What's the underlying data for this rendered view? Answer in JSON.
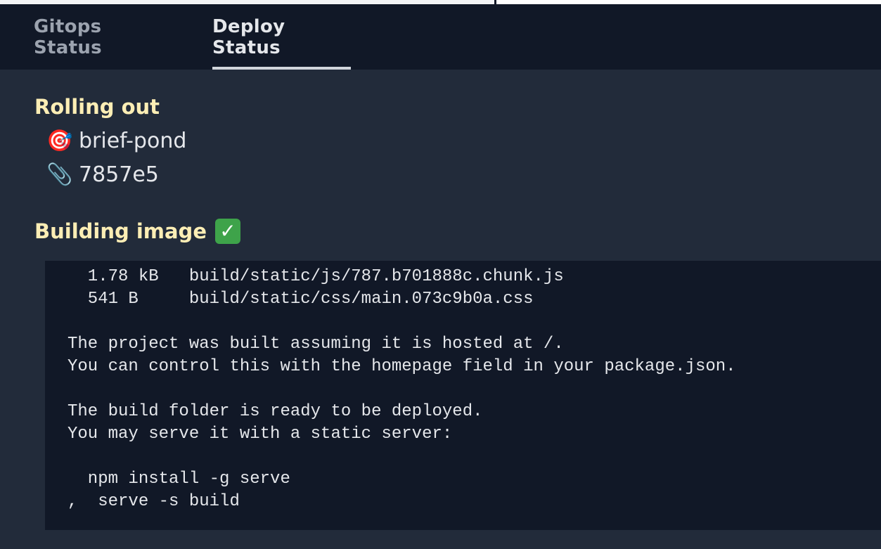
{
  "tabs": [
    {
      "label": "Gitops Status",
      "active": false
    },
    {
      "label": "Deploy Status",
      "active": true
    }
  ],
  "rolling_out": {
    "title": "Rolling out",
    "target": {
      "emoji": "🎯",
      "icon": "target-icon",
      "value": "brief-pond"
    },
    "commit": {
      "emoji": "📎",
      "icon": "paperclip-icon",
      "value": "7857e5"
    }
  },
  "building_image": {
    "title": "Building image",
    "status_icon": "check-mark-icon",
    "status_glyph": "✓",
    "status_color": "#3ea34a"
  },
  "log": {
    "lines": [
      "  1.78 kB   build/static/js/787.b701888c.chunk.js",
      "  541 B     build/static/css/main.073c9b0a.css",
      "",
      "The project was built assuming it is hosted at /.",
      "You can control this with the homepage field in your package.json.",
      "",
      "The build folder is ready to be deployed.",
      "You may serve it with a static server:",
      "",
      "  npm install -g serve",
      ",  serve -s build"
    ]
  },
  "colors": {
    "tab_bar_bg": "#111827",
    "main_bg": "#222b3a",
    "heading_color": "#fdeeb5",
    "log_bg": "#111827"
  }
}
